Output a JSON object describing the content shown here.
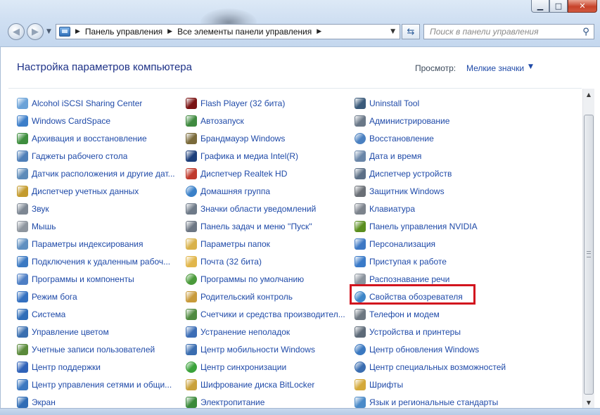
{
  "window": {
    "caption_buttons": {
      "minimize": "▁",
      "maximize": "□",
      "close": "✕"
    }
  },
  "toolbar": {
    "back_glyph": "◀",
    "forward_glyph": "▶",
    "address_icon": "control-panel-icon",
    "breadcrumbs": [
      "Панель управления",
      "Все элементы панели управления"
    ],
    "search_placeholder": "Поиск в панели управления",
    "search_icon": "magnifier-icon",
    "refresh_icon": "refresh-icon"
  },
  "header": {
    "title": "Настройка параметров компьютера",
    "view_label": "Просмотр:",
    "view_value": "Мелкие значки"
  },
  "columns": [
    [
      {
        "label": "Alcohol iSCSI Sharing Center",
        "icon": "alcohol-icon",
        "color": "#6aa2d8"
      },
      {
        "label": "Windows CardSpace",
        "icon": "cardspace-icon",
        "color": "#3c7ec9"
      },
      {
        "label": "Архивация и восстановление",
        "icon": "backup-icon",
        "color": "#3e8e3e"
      },
      {
        "label": "Гаджеты рабочего стола",
        "icon": "gadgets-icon",
        "color": "#4f7fb8"
      },
      {
        "label": "Датчик расположения и другие дат...",
        "icon": "sensor-icon",
        "color": "#5d8bb9"
      },
      {
        "label": "Диспетчер учетных данных",
        "icon": "credentials-icon",
        "color": "#c49b2d"
      },
      {
        "label": "Звук",
        "icon": "sound-icon",
        "color": "#7d8793"
      },
      {
        "label": "Мышь",
        "icon": "mouse-icon",
        "color": "#8e959e"
      },
      {
        "label": "Параметры индексирования",
        "icon": "indexing-icon",
        "color": "#5f8fc0"
      },
      {
        "label": "Подключения к удаленным рабоч...",
        "icon": "remote-desktop-icon",
        "color": "#3b79c2"
      },
      {
        "label": "Программы и компоненты",
        "icon": "programs-icon",
        "color": "#4d7ec4"
      },
      {
        "label": "Режим бога",
        "icon": "god-mode-icon",
        "color": "#3470c0"
      },
      {
        "label": "Система",
        "icon": "system-icon",
        "color": "#2f6db8"
      },
      {
        "label": "Управление цветом",
        "icon": "color-management-icon",
        "color": "#3a6fb0"
      },
      {
        "label": "Учетные записи пользователей",
        "icon": "users-icon",
        "color": "#5a8a3a"
      },
      {
        "label": "Центр поддержки",
        "icon": "action-center-flag-icon",
        "color": "#2f62b8"
      },
      {
        "label": "Центр управления сетями и общи...",
        "icon": "network-icon",
        "color": "#3c78c0"
      },
      {
        "label": "Экран",
        "icon": "display-icon",
        "color": "#2f6cb5"
      }
    ],
    [
      {
        "label": "Flash Player (32 бита)",
        "icon": "flash-icon",
        "color": "#7a1313"
      },
      {
        "label": "Автозапуск",
        "icon": "autoplay-icon",
        "color": "#3f8a3f"
      },
      {
        "label": "Брандмауэр Windows",
        "icon": "firewall-icon",
        "color": "#7a6a3a"
      },
      {
        "label": "Графика и медиа Intel(R)",
        "icon": "intel-graphics-icon",
        "color": "#1c3e7a"
      },
      {
        "label": "Диспетчер Realtek HD",
        "icon": "realtek-icon",
        "color": "#c0392b"
      },
      {
        "label": "Домашняя группа",
        "icon": "homegroup-icon",
        "color": "#3a80c8"
      },
      {
        "label": "Значки области уведомлений",
        "icon": "notification-icons-icon",
        "color": "#6e7a88"
      },
      {
        "label": "Панель задач и меню ''Пуск''",
        "icon": "taskbar-icon",
        "color": "#6c7683"
      },
      {
        "label": "Параметры папок",
        "icon": "folder-options-icon",
        "color": "#d9b24a"
      },
      {
        "label": "Почта (32 бита)",
        "icon": "mail-icon",
        "color": "#e1b64b"
      },
      {
        "label": "Программы по умолчанию",
        "icon": "default-programs-icon",
        "color": "#4a9a3a"
      },
      {
        "label": "Родительский контроль",
        "icon": "parental-controls-icon",
        "color": "#c89a3a"
      },
      {
        "label": "Счетчики и средства производител...",
        "icon": "performance-icon",
        "color": "#4f8a3f"
      },
      {
        "label": "Устранение неполадок",
        "icon": "troubleshooting-icon",
        "color": "#3d6eb6"
      },
      {
        "label": "Центр мобильности Windows",
        "icon": "mobility-center-icon",
        "color": "#3a6db0"
      },
      {
        "label": "Центр синхронизации",
        "icon": "sync-center-icon",
        "color": "#3aa23a"
      },
      {
        "label": "Шифрование диска BitLocker",
        "icon": "bitlocker-icon",
        "color": "#c9a13a"
      },
      {
        "label": "Электропитание",
        "icon": "power-icon",
        "color": "#3a8a3a"
      }
    ],
    [
      {
        "label": "Uninstall Tool",
        "icon": "uninstall-tool-icon",
        "color": "#3a5a7a"
      },
      {
        "label": "Администрирование",
        "icon": "admin-tools-icon",
        "color": "#6a7888"
      },
      {
        "label": "Восстановление",
        "icon": "recovery-icon",
        "color": "#4a80c0"
      },
      {
        "label": "Дата и время",
        "icon": "date-time-icon",
        "color": "#6a86a8"
      },
      {
        "label": "Диспетчер устройств",
        "icon": "device-manager-icon",
        "color": "#5c6f86"
      },
      {
        "label": "Защитник Windows",
        "icon": "defender-icon",
        "color": "#6a6f76"
      },
      {
        "label": "Клавиатура",
        "icon": "keyboard-icon",
        "color": "#7c838c"
      },
      {
        "label": "Панель управления NVIDIA",
        "icon": "nvidia-icon",
        "color": "#5a8e1e"
      },
      {
        "label": "Персонализация",
        "icon": "personalization-icon",
        "color": "#3d78c4"
      },
      {
        "label": "Приступая к работе",
        "icon": "getting-started-icon",
        "color": "#3a7ac8"
      },
      {
        "label": "Распознавание речи",
        "icon": "speech-icon",
        "color": "#8a929c"
      },
      {
        "label": "Свойства обозревателя",
        "icon": "internet-options-icon",
        "color": "#3e86c8"
      },
      {
        "label": "Телефон и модем",
        "icon": "phone-modem-icon",
        "color": "#6d7781"
      },
      {
        "label": "Устройства и принтеры",
        "icon": "printer-icon",
        "color": "#5d6a78"
      },
      {
        "label": "Центр обновления Windows",
        "icon": "windows-update-icon",
        "color": "#3a78c0"
      },
      {
        "label": "Центр специальных возможностей",
        "icon": "accessibility-icon",
        "color": "#3a6db0"
      },
      {
        "label": "Шрифты",
        "icon": "fonts-icon",
        "color": "#d4a93a"
      },
      {
        "label": "Язык и региональные стандарты",
        "icon": "region-icon",
        "color": "#4a8ac8"
      }
    ]
  ],
  "highlight_color": "#d2141e"
}
